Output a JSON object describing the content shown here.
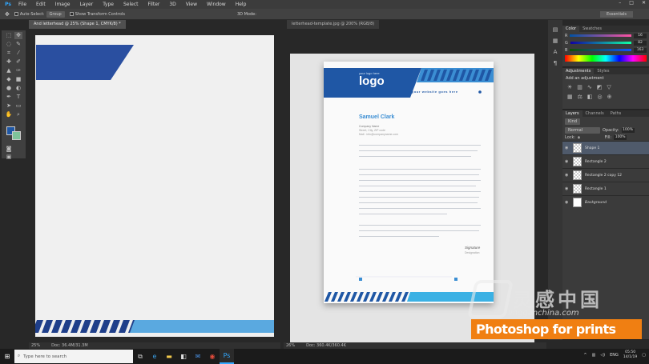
{
  "app": {
    "logo": "Ps",
    "menu": [
      "File",
      "Edit",
      "Image",
      "Layer",
      "Type",
      "Select",
      "Filter",
      "3D",
      "View",
      "Window",
      "Help"
    ],
    "window_controls": [
      "–",
      "□",
      "✕"
    ]
  },
  "options_bar": {
    "auto_select_label": "Auto-Select:",
    "auto_select_value": "Group",
    "transform_label": "Show Transform Controls",
    "mode_label": "3D Mode:",
    "workspace": "Essentials"
  },
  "tabs": {
    "left": "And letterhead @ 25% (Shape 1, CMYK/8) *",
    "right": "letterhead-template.jpg @ 200% (RGB/8)"
  },
  "status": {
    "left_zoom": "25%",
    "left_doc": "Doc: 36.4M/31.3M",
    "right_zoom": "26%",
    "right_doc": "Doc: 360.4K/360.4K"
  },
  "letterhead": {
    "logo_small": "your logo here",
    "logo": "logo",
    "website": "your website goes here",
    "name": "Samuel Clark",
    "position": "Company Name",
    "address1": "Street, City, ZIP code",
    "address2": "Mail : info@companyname.com",
    "signature": "Signature",
    "sign_title": "Designation"
  },
  "panels": {
    "color_tabs": [
      "Color",
      "Swatches"
    ],
    "sliders": [
      {
        "label": "R",
        "value": "16"
      },
      {
        "label": "G",
        "value": "82"
      },
      {
        "label": "B",
        "value": "163"
      }
    ],
    "adjust_tabs": [
      "Adjustments",
      "Styles"
    ],
    "adjust_title": "Add an adjustment",
    "layers_tabs": [
      "Layers",
      "Channels",
      "Paths"
    ],
    "kind_label": "Kind",
    "blend_mode": "Normal",
    "opacity_label": "Opacity:",
    "opacity": "100%",
    "lock_label": "Lock:",
    "fill_label": "Fill:",
    "fill": "100%",
    "layers": [
      {
        "name": "Shape 1",
        "selected": true,
        "thumb": "transparent"
      },
      {
        "name": "Rectangle 2",
        "selected": false,
        "thumb": "transparent"
      },
      {
        "name": "Rectangle 2 copy 12",
        "selected": false,
        "thumb": "transparent"
      },
      {
        "name": "Rectangle 1",
        "selected": false,
        "thumb": "transparent"
      },
      {
        "name": "Background",
        "selected": false,
        "thumb": "white"
      }
    ]
  },
  "taskbar": {
    "search_placeholder": "Type here to search",
    "lang": "ENG",
    "time": "05:50",
    "date": "14/1/19"
  },
  "watermark": {
    "cn": "灵感中国",
    "url": "lingganchina.com",
    "banner": "Photoshop for prints"
  },
  "colors": {
    "accent_blue": "#1f57a5",
    "light_blue": "#5aa9e0",
    "banner": "#f07f12"
  }
}
